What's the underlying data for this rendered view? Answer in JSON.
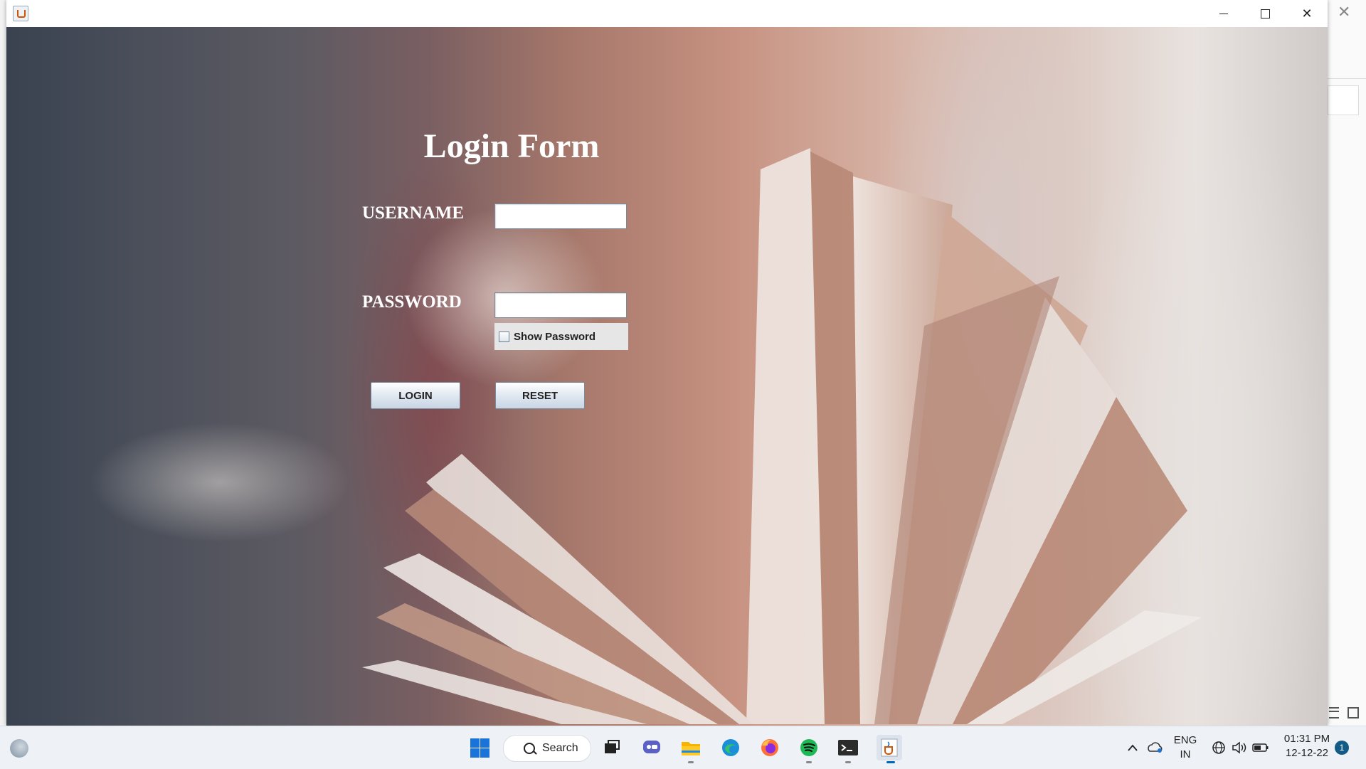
{
  "window": {
    "title": ""
  },
  "form": {
    "title": "Login Form",
    "username_label": "USERNAME",
    "password_label": "PASSWORD",
    "username_value": "",
    "password_value": "",
    "show_password_label": "Show Password",
    "show_password_checked": false,
    "login_button": "LOGIN",
    "reset_button": "RESET"
  },
  "taskbar": {
    "search_label": "Search",
    "language_primary": "ENG",
    "language_secondary": "IN",
    "time": "01:31 PM",
    "date": "12-12-22",
    "notification_count": "1",
    "pinned_apps": [
      "start-icon",
      "search",
      "task-view-icon",
      "chat-icon",
      "file-explorer-icon",
      "edge-icon",
      "firefox-icon",
      "spotify-icon",
      "terminal-icon",
      "java-icon"
    ]
  }
}
